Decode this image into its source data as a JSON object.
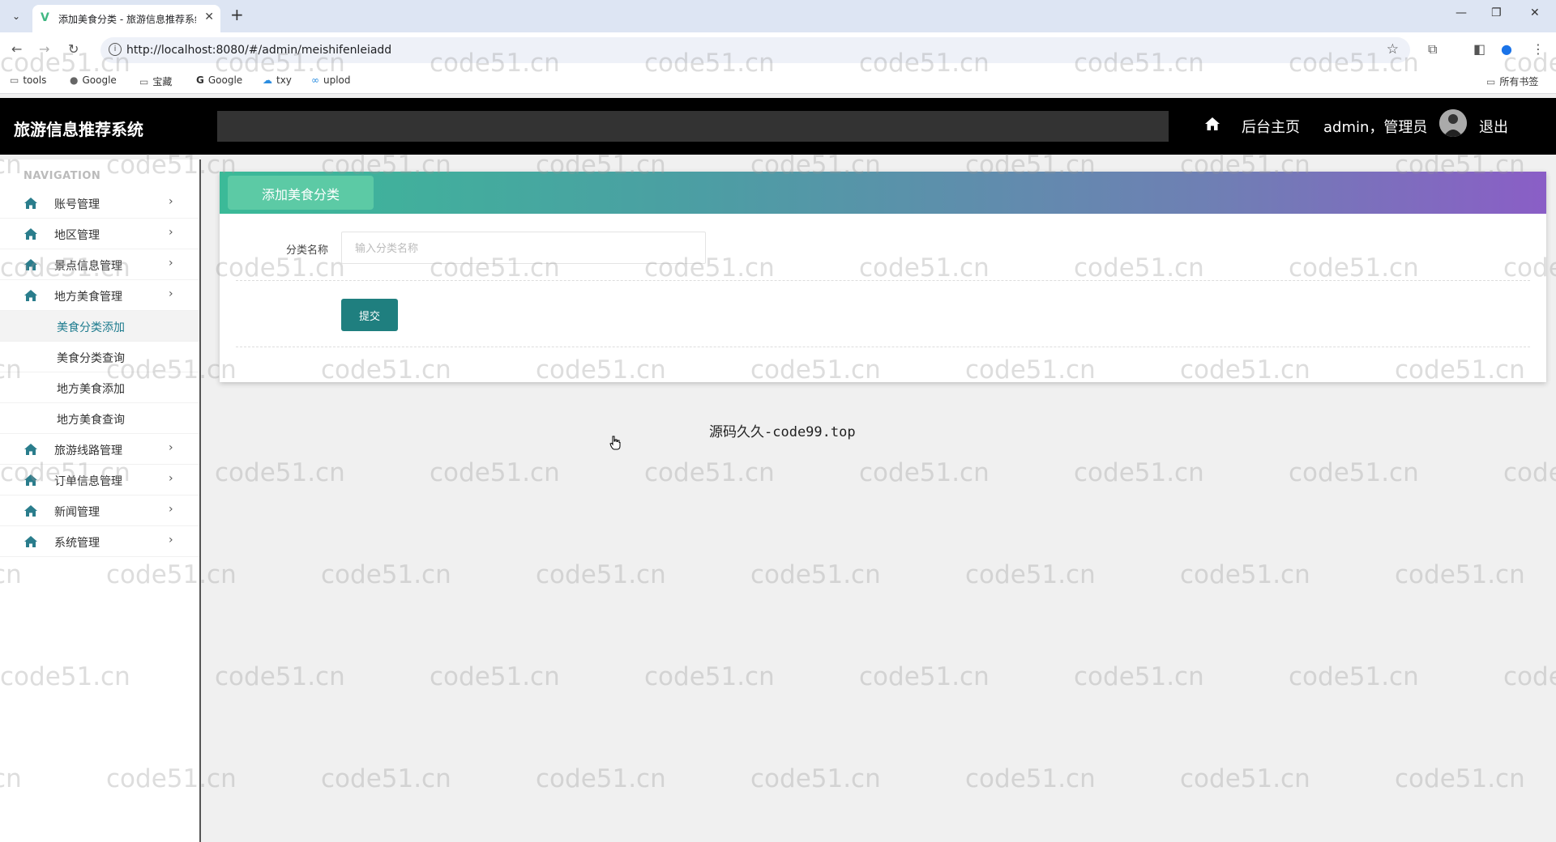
{
  "browser": {
    "tab_title": "添加美食分类 - 旅游信息推荐系统",
    "url": "http://localhost:8080/#/admin/meishifenleiadd",
    "bookmarks": [
      {
        "label": "tools",
        "icon": "folder-icon"
      },
      {
        "label": "Google",
        "icon": "globe-icon"
      },
      {
        "label": "宝藏",
        "icon": "folder-icon"
      },
      {
        "label": "Google",
        "icon": "google-icon"
      },
      {
        "label": "txy",
        "icon": "cloud-icon"
      },
      {
        "label": "uplod",
        "icon": "link-icon"
      }
    ],
    "all_bookmarks": "所有书签"
  },
  "header": {
    "title": "旅游信息推荐系统",
    "home_link": "后台主页",
    "user": "admin，管理员",
    "logout": "退出"
  },
  "sidebar": {
    "heading": "NAVIGATION",
    "items": [
      {
        "label": "账号管理"
      },
      {
        "label": "地区管理"
      },
      {
        "label": "景点信息管理"
      },
      {
        "label": "地方美食管理"
      },
      {
        "label": "旅游线路管理"
      },
      {
        "label": "订单信息管理"
      },
      {
        "label": "新闻管理"
      },
      {
        "label": "系统管理"
      }
    ],
    "subitems": [
      {
        "label": "美食分类添加",
        "active": true
      },
      {
        "label": "美食分类查询",
        "active": false
      },
      {
        "label": "地方美食添加",
        "active": false
      },
      {
        "label": "地方美食查询",
        "active": false
      }
    ]
  },
  "form": {
    "tab_title": "添加美食分类",
    "field_label": "分类名称",
    "field_placeholder": "输入分类名称",
    "field_value": "",
    "submit_label": "提交"
  },
  "footer": {
    "text": "源码久久-code99.top"
  },
  "watermark": "code51.cn",
  "colors": {
    "accent": "#1f7f7f",
    "header_bg": "#000000",
    "gradient_start": "#3bba98",
    "gradient_end": "#8a5ec6"
  }
}
